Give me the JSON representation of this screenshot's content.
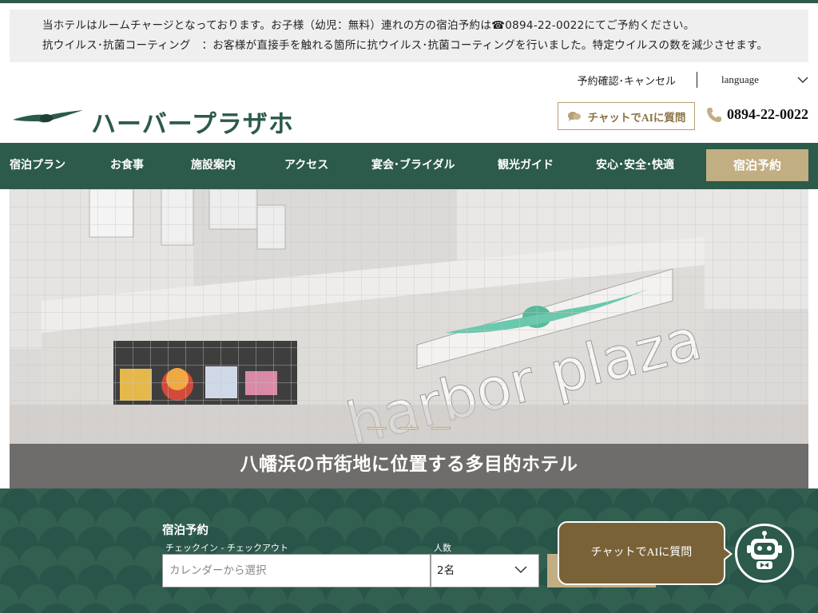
{
  "notice": {
    "line1": "当ホテルはルームチャージとなっております。お子様（幼児：無料）連れの方の宿泊予約は☎0894-22-0022にてご予約ください。",
    "line2": "抗ウイルス･抗菌コーティング　：お客様が直接手を触れる箇所に抗ウイルス･抗菌コーティングを行いました。特定ウイルスの数を減少させます。"
  },
  "utility": {
    "reservation_link": "予約確認･キャンセル",
    "language_label": "language"
  },
  "brand": {
    "logo_text": "ハーバープラザホテル"
  },
  "header": {
    "chat_button": "チャットでAIに質問",
    "phone": "0894-22-0022"
  },
  "nav": {
    "items": [
      "宿泊プラン",
      "お食事",
      "施設案内",
      "アクセス",
      "宴会･ブライダル",
      "観光ガイド",
      "安心･安全･快適"
    ],
    "book_button": "宿泊予約"
  },
  "hero": {
    "sign_text": "harbor plaza",
    "caption": "八幡浜の市街地に位置する多目的ホテル",
    "slides": 3
  },
  "booking": {
    "title": "宿泊予約",
    "date_label": "チェックイン - チェックアウト",
    "date_placeholder": "カレンダーから選択",
    "guests_label": "人数",
    "guests_value": "2名"
  },
  "chat_widget": {
    "bubble_text": "チャットでAIに質問"
  },
  "colors": {
    "brand_green": "#2c5a4b",
    "gold": "#c2ae83",
    "chat_brown": "#7a6238"
  }
}
